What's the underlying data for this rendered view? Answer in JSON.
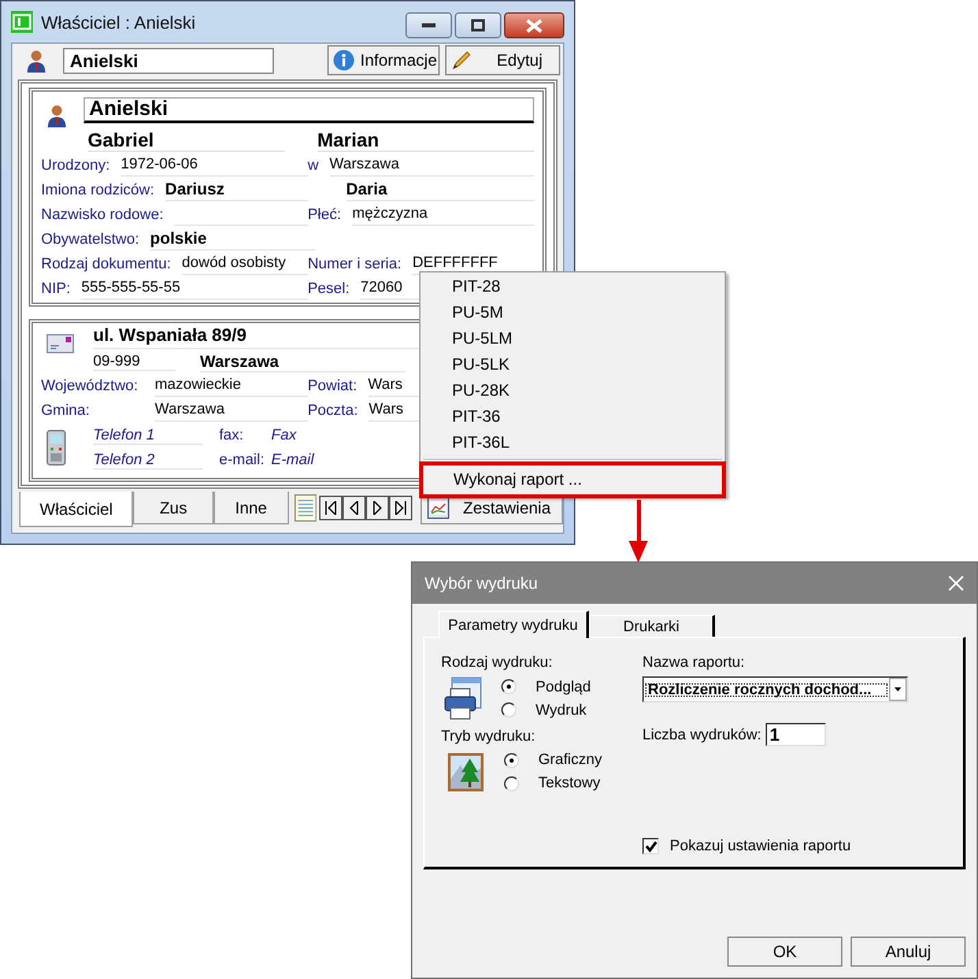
{
  "owner_window": {
    "title": "Właściciel : Anielski",
    "name_field": "Anielski",
    "buttons": [
      {
        "label": "Informacje",
        "kind": "info"
      },
      {
        "label": "Edytuj",
        "kind": "edit"
      }
    ],
    "person": {
      "surname": "Anielski",
      "first_name": "Gabriel",
      "second_name": "Marian",
      "rows": [
        {
          "left": {
            "label": "Urodzony:",
            "value": "1972-06-06"
          },
          "right": {
            "label": "w",
            "value": "Warszawa"
          }
        },
        {
          "left": {
            "label": "Imiona rodziców:",
            "value": "Dariusz",
            "bold": true
          },
          "right": {
            "value": "Daria",
            "bold": true
          }
        },
        {
          "left": {
            "label": "Nazwisko rodowe:"
          },
          "right": {
            "label": "Płeć:",
            "value": "mężczyzna"
          }
        },
        {
          "left": {
            "label": "Obywatelstwo:",
            "value": "polskie",
            "bold": true
          }
        },
        {
          "left": {
            "label": "Rodzaj dokumentu:",
            "value": "dowód osobisty"
          },
          "right": {
            "label": "Numer i seria:",
            "value": "DEFFFFFFF"
          }
        },
        {
          "left": {
            "label": "NIP:",
            "value": "555-555-55-55"
          },
          "right": {
            "label": "Pesel:",
            "value": "72060"
          }
        }
      ]
    },
    "address": {
      "street": "ul. Wspaniała 89/9",
      "postcode": "09-999",
      "city": "Warszawa",
      "rows": [
        {
          "left": {
            "label": "Województwo:",
            "value": "mazowieckie"
          },
          "right": {
            "label": "Powiat:",
            "value": "Wars"
          }
        },
        {
          "left": {
            "label": "Gmina:",
            "value": "Warszawa"
          },
          "right": {
            "label": "Poczta:",
            "value": "Wars"
          }
        }
      ],
      "contacts": [
        {
          "phone": "Telefon 1",
          "label": "fax:",
          "value": "Fax"
        },
        {
          "phone": "Telefon 2",
          "label": "e-mail:",
          "value": "E-mail"
        }
      ]
    },
    "tabs": [
      {
        "label": "Właściciel",
        "selected": true
      },
      {
        "label": "Zus",
        "selected": false
      },
      {
        "label": "Inne",
        "selected": false
      }
    ],
    "reports_button": "Zestawienia"
  },
  "menu": {
    "items": [
      {
        "label": "PIT-28",
        "kind": "item",
        "marked": false
      },
      {
        "label": "PU-5M",
        "kind": "item",
        "marked": false
      },
      {
        "label": "PU-5LM",
        "kind": "item",
        "marked": false
      },
      {
        "label": "PU-5LK",
        "kind": "item",
        "marked": false
      },
      {
        "label": "PU-28K",
        "kind": "item",
        "marked": false
      },
      {
        "label": "PIT-36",
        "kind": "item",
        "marked": false
      },
      {
        "label": "PIT-36L",
        "kind": "item",
        "marked": false
      },
      {
        "kind": "separator"
      },
      {
        "label": "Wykonaj raport ...",
        "kind": "item",
        "marked": true
      }
    ]
  },
  "print_dialog": {
    "title": "Wybór wydruku",
    "tabs": [
      {
        "label": "Parametry wydruku",
        "selected": true
      },
      {
        "label": "Drukarki",
        "selected": false
      }
    ],
    "output_type": {
      "label": "Rodzaj wydruku:",
      "options": [
        {
          "label": "Podgląd",
          "selected": true
        },
        {
          "label": "Wydruk",
          "selected": false
        }
      ]
    },
    "print_mode": {
      "label": "Tryb wydruku:",
      "options": [
        {
          "label": "Graficzny",
          "selected": true
        },
        {
          "label": "Tekstowy",
          "selected": false
        }
      ]
    },
    "report_name": {
      "label": "Nazwa raportu:",
      "value": "Rozliczenie rocznych dochod..."
    },
    "copies": {
      "label": "Liczba wydruków:",
      "value": "1"
    },
    "show_settings": {
      "label": "Pokazuj ustawienia raportu",
      "checked": true
    },
    "buttons": [
      "OK",
      "Anuluj"
    ]
  }
}
